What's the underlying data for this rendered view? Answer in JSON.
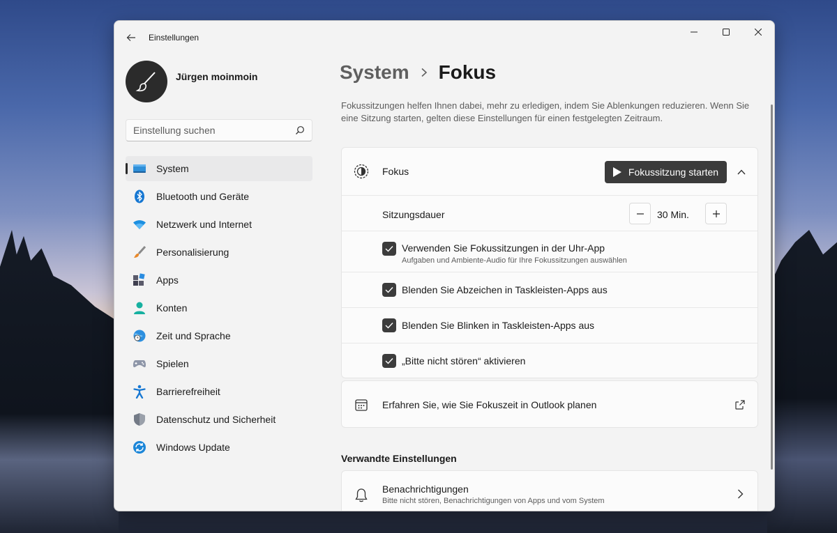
{
  "window": {
    "title": "Einstellungen"
  },
  "user": {
    "name": "Jürgen moinmoin"
  },
  "search": {
    "placeholder": "Einstellung suchen"
  },
  "sidebar": {
    "items": [
      {
        "label": "System",
        "icon": "system-icon",
        "active": true
      },
      {
        "label": "Bluetooth und Geräte",
        "icon": "bluetooth-icon"
      },
      {
        "label": "Netzwerk und Internet",
        "icon": "wifi-icon"
      },
      {
        "label": "Personalisierung",
        "icon": "brush-icon"
      },
      {
        "label": "Apps",
        "icon": "apps-icon"
      },
      {
        "label": "Konten",
        "icon": "person-icon"
      },
      {
        "label": "Zeit und Sprache",
        "icon": "globe-clock-icon"
      },
      {
        "label": "Spielen",
        "icon": "gamepad-icon"
      },
      {
        "label": "Barrierefreiheit",
        "icon": "accessibility-icon"
      },
      {
        "label": "Datenschutz und Sicherheit",
        "icon": "shield-icon"
      },
      {
        "label": "Windows Update",
        "icon": "update-icon"
      }
    ]
  },
  "breadcrumb": {
    "parent": "System",
    "current": "Fokus"
  },
  "description": "Fokussitzungen helfen Ihnen dabei, mehr zu erledigen, indem Sie Ablenkungen reduzieren. Wenn Sie eine Sitzung starten, gelten diese Einstellungen für einen festgelegten Zeitraum.",
  "focus": {
    "label": "Fokus",
    "start_button": "Fokussitzung starten",
    "duration_label": "Sitzungsdauer",
    "duration_value": "30 Min.",
    "options": [
      {
        "label": "Verwenden Sie Fokussitzungen in der Uhr-App",
        "sub": "Aufgaben und Ambiente-Audio für Ihre Fokussitzungen auswählen",
        "checked": true
      },
      {
        "label": "Blenden Sie Abzeichen in Taskleisten-Apps aus",
        "checked": true
      },
      {
        "label": "Blenden Sie Blinken in Taskleisten-Apps aus",
        "checked": true
      },
      {
        "label": "„Bitte nicht stören“ aktivieren",
        "checked": true
      }
    ]
  },
  "outlook": {
    "label": "Erfahren Sie, wie Sie Fokuszeit in Outlook planen"
  },
  "related": {
    "heading": "Verwandte Einstellungen",
    "notifications": {
      "label": "Benachrichtigungen",
      "sub": "Bitte nicht stören, Benachrichtigungen von Apps und vom System"
    }
  },
  "colors": {
    "accent": "#0067c0",
    "button_dark": "#3b3b3b",
    "window_bg": "#f3f3f3",
    "card_bg": "#fbfbfb"
  }
}
